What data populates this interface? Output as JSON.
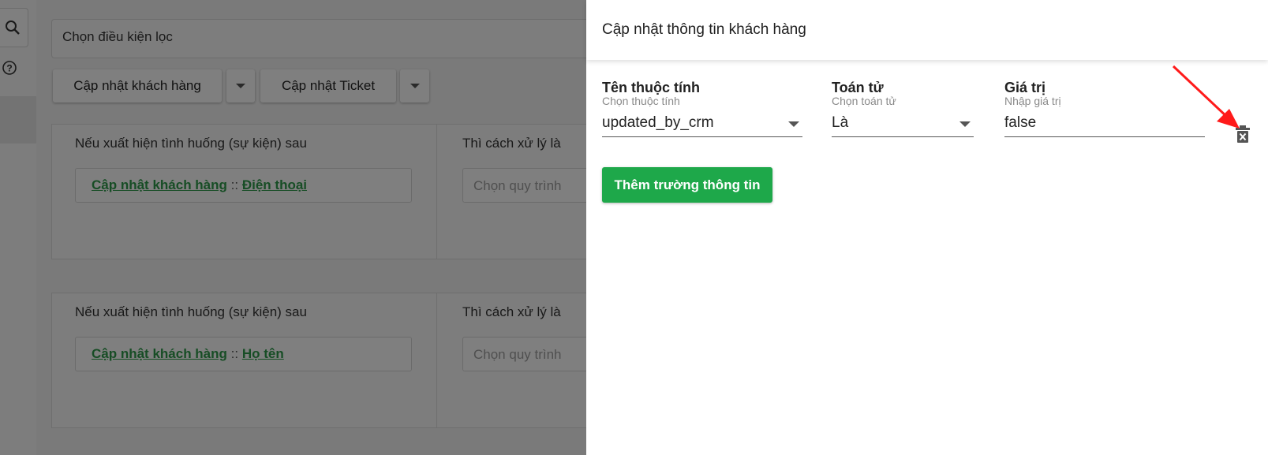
{
  "background": {
    "filter_placeholder": "Chọn điều kiện lọc",
    "toolbar": {
      "update_customer_label": "Cập nhật khách hàng",
      "update_ticket_label": "Cập nhật Ticket"
    },
    "rules": [
      {
        "event_title": "Nếu xuất hiện tình huống (sự kiện) sau",
        "event_entity": "Cập nhật khách hàng",
        "event_separator": "::",
        "event_field": "Điện thoại",
        "action_title": "Thì cách xử lý là",
        "process_placeholder": "Chọn quy trình"
      },
      {
        "event_title": "Nếu xuất hiện tình huống (sự kiện) sau",
        "event_entity": "Cập nhật khách hàng",
        "event_separator": "::",
        "event_field": "Họ tên",
        "action_title": "Thì cách xử lý là",
        "process_placeholder": "Chọn quy trình"
      }
    ]
  },
  "drawer": {
    "title": "Cập nhật thông tin khách hàng",
    "fields": {
      "attribute": {
        "label": "Tên thuộc tính",
        "hint": "Chọn thuộc tính",
        "value": "updated_by_crm"
      },
      "operator": {
        "label": "Toán tử",
        "hint": "Chọn toán tử",
        "value": "Là"
      },
      "value": {
        "label": "Giá trị",
        "hint": "Nhập giá trị",
        "value": "false"
      }
    },
    "add_field_label": "Thêm trường thông tin"
  },
  "colors": {
    "accent_green": "#1ea84a",
    "link_green": "#2e9b4b",
    "annotation_red": "#ff1a1a"
  },
  "icons": [
    "search-icon",
    "help-icon",
    "chevron-down-icon",
    "delete-icon",
    "annotation-arrow"
  ]
}
